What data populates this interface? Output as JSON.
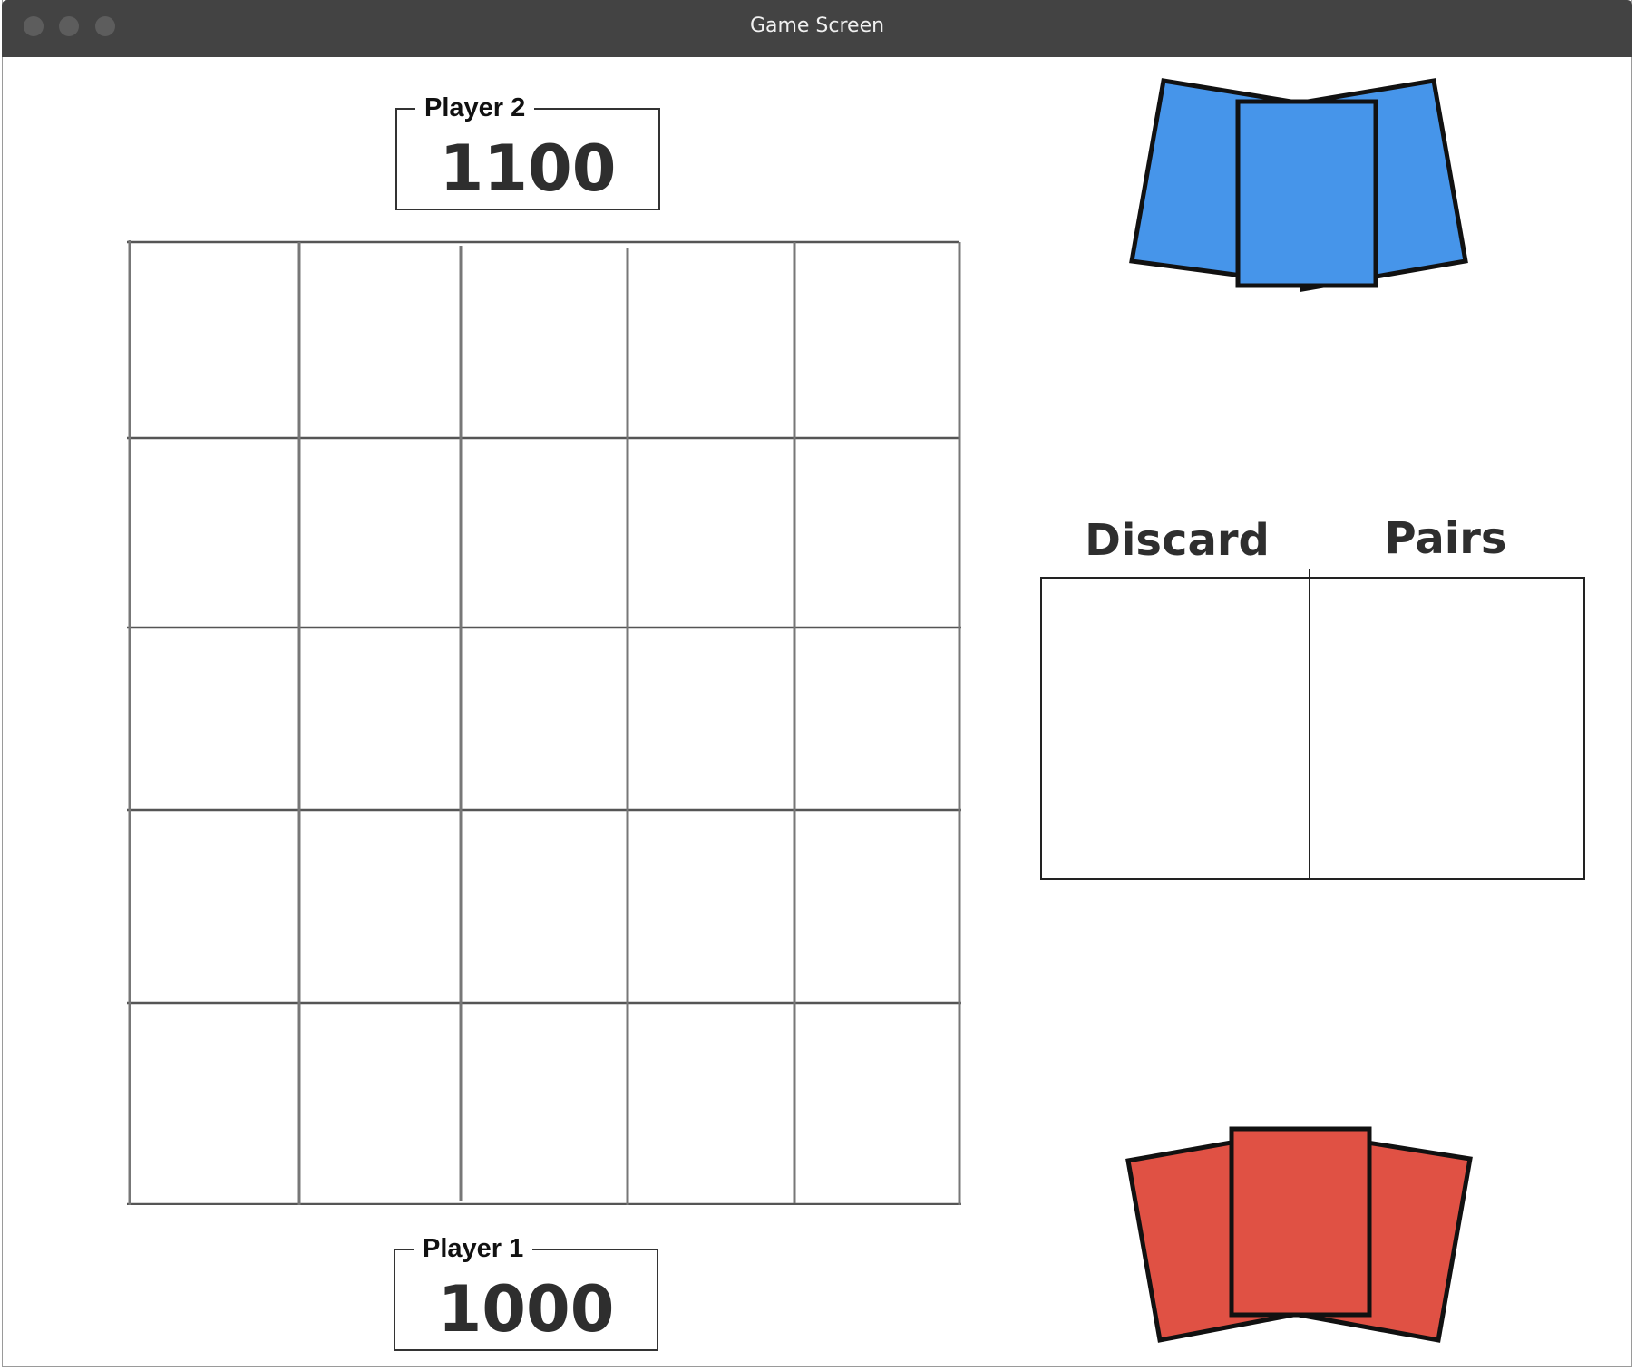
{
  "window": {
    "title": "Game Screen"
  },
  "player2": {
    "label": "Player 2",
    "score": "1100",
    "card_color": "#4695ea"
  },
  "player1": {
    "label": "Player 1",
    "score": "1000",
    "card_color": "#e05144"
  },
  "board": {
    "rows": 5,
    "columns": 5
  },
  "piles": {
    "discard_label": "Discard",
    "pairs_label": "Pairs"
  },
  "colors": {
    "titlebar": "#434343",
    "grid_line": "#777777",
    "card_outline": "#111111"
  }
}
